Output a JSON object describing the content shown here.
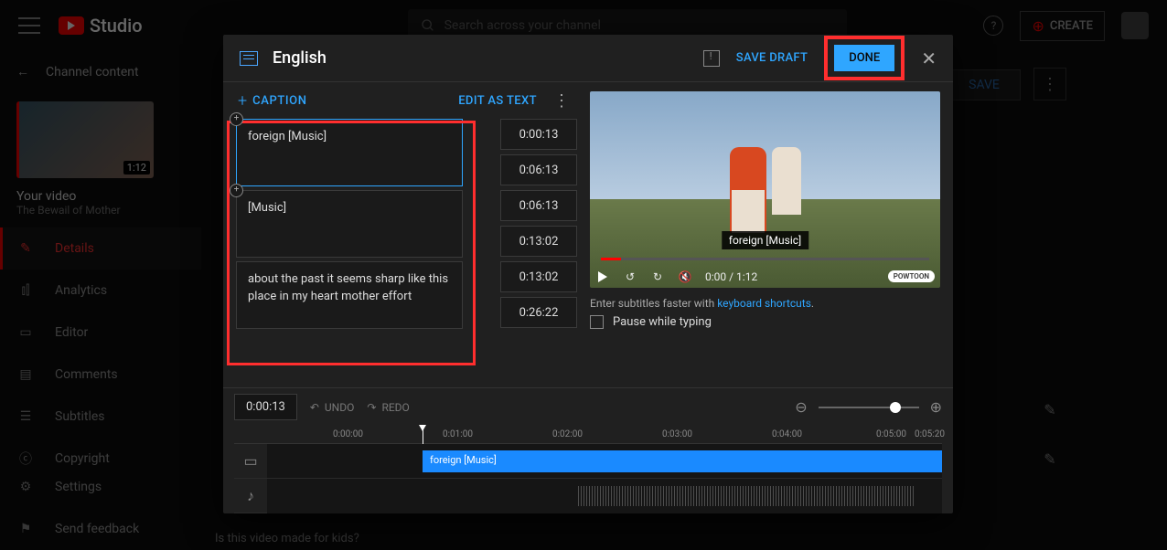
{
  "topbar": {
    "brand": "Studio",
    "search_placeholder": "Search across your channel",
    "create_label": "CREATE"
  },
  "sidebar": {
    "back_label": "Channel content",
    "thumb_duration": "1:12",
    "your_video": "Your video",
    "video_title": "The Bewail of Mother",
    "items": [
      {
        "label": "Details"
      },
      {
        "label": "Analytics"
      },
      {
        "label": "Editor"
      },
      {
        "label": "Comments"
      },
      {
        "label": "Subtitles"
      },
      {
        "label": "Copyright"
      }
    ],
    "footer": [
      {
        "label": "Settings"
      },
      {
        "label": "Send feedback"
      }
    ]
  },
  "bg": {
    "save": "SAVE",
    "kids_q": "Is this video made for kids?"
  },
  "modal": {
    "language": "English",
    "save_draft": "SAVE DRAFT",
    "done": "DONE",
    "caption_btn": "CAPTION",
    "edit_as_text": "EDIT AS TEXT",
    "captions": [
      {
        "text": "foreign [Music]",
        "start": "0:00:13",
        "end": "0:06:13"
      },
      {
        "text": "[Music]",
        "start": "0:06:13",
        "end": "0:13:02"
      },
      {
        "text": "about the past it seems sharp like this place in my heart mother effort",
        "start": "0:13:02",
        "end": "0:26:22"
      }
    ],
    "preview": {
      "caption_overlay": "foreign [Music]",
      "time_display": "0:00 / 1:12",
      "badge": "POWTOON"
    },
    "hint_pre": "Enter subtitles faster with ",
    "hint_link": "keyboard shortcuts",
    "pause_label": "Pause while typing",
    "timeline": {
      "current": "0:00:13",
      "undo": "UNDO",
      "redo": "REDO",
      "ticks": [
        "0:00:00",
        "0:01:00",
        "0:02:00",
        "0:03:00",
        "0:04:00",
        "0:05:00",
        "0:05:20"
      ],
      "cap_block": "foreign [Music]"
    }
  }
}
